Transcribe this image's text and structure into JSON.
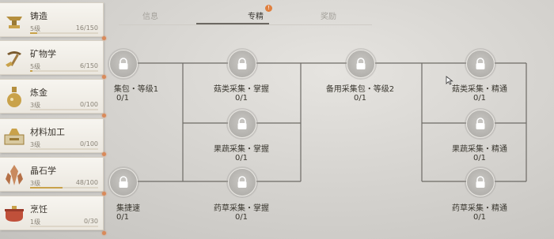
{
  "sidebar": {
    "skills": [
      {
        "name": "铸造",
        "level": "5级",
        "xp": "16/150",
        "progress": 0.107,
        "icon": "anvil-icon"
      },
      {
        "name": "矿物学",
        "level": "5级",
        "xp": "6/150",
        "progress": 0.04,
        "icon": "pickaxe-icon"
      },
      {
        "name": "炼金",
        "level": "3级",
        "xp": "0/100",
        "progress": 0.0,
        "icon": "potion-icon"
      },
      {
        "name": "材料加工",
        "level": "3级",
        "xp": "0/100",
        "progress": 0.0,
        "icon": "materials-icon"
      },
      {
        "name": "晶石学",
        "level": "3级",
        "xp": "48/100",
        "progress": 0.48,
        "icon": "crystal-icon"
      },
      {
        "name": "烹饪",
        "level": "1级",
        "xp": "0/30",
        "progress": 0.0,
        "icon": "cooking-pot-icon"
      }
    ]
  },
  "tabs": {
    "items": [
      {
        "label": "信息"
      },
      {
        "label": "专精"
      },
      {
        "label": "奖励"
      }
    ],
    "active": "专精",
    "badge": "!"
  },
  "tree": {
    "nodes": [
      {
        "label": "集包・等级1",
        "count": "0/1"
      },
      {
        "label": "菇类采集・掌握",
        "count": "0/1"
      },
      {
        "label": "备用采集包・等级2",
        "count": "0/1"
      },
      {
        "label": "菇类采集・精通",
        "count": "0/1"
      },
      {
        "label": "果蔬采集・掌握",
        "count": "0/1"
      },
      {
        "label": "果蔬采集・精通",
        "count": "0/1"
      },
      {
        "label": "集捷速",
        "count": "0/1"
      },
      {
        "label": "药草采集・掌握",
        "count": "0/1"
      },
      {
        "label": "药草采集・精通",
        "count": "0/1"
      }
    ]
  },
  "colors": {
    "accent_gold": "#c9a24a",
    "notify_orange": "#e0803f",
    "node_gray": "#b3b1ad",
    "line_gray": "#6e6b66"
  }
}
